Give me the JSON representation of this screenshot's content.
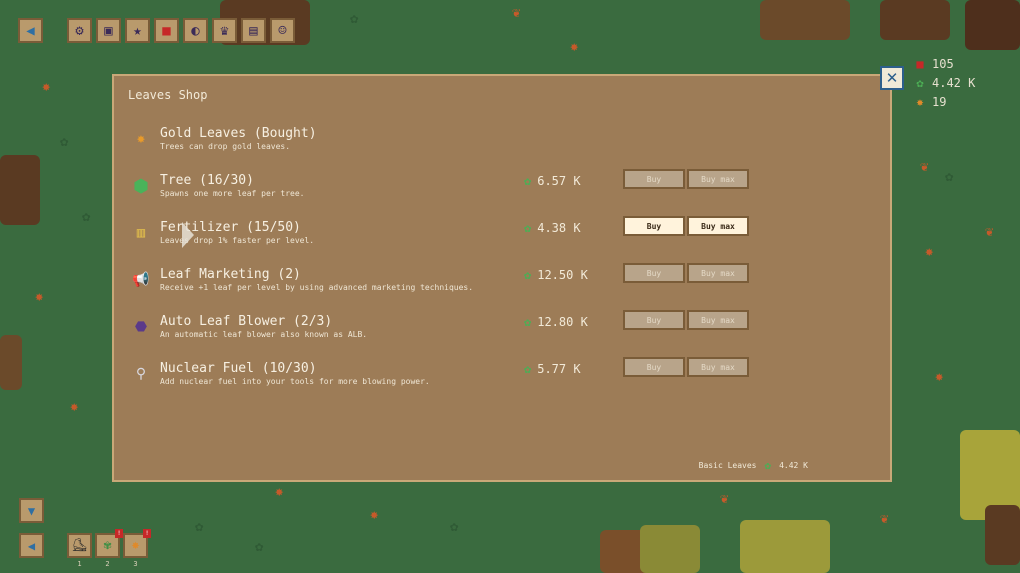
{
  "toolbar": {
    "icons": [
      "back-icon",
      "gear-icon",
      "briefcase-icon",
      "star-icon",
      "gem-icon",
      "moon-icon",
      "trophy-icon",
      "book-icon",
      "person-icon"
    ]
  },
  "stats": {
    "gems": "105",
    "leaves": "4.42 K",
    "gold_leaves": "19"
  },
  "shop": {
    "title": "Leaves Shop",
    "items": [
      {
        "name": "Gold Leaves (Bought)",
        "desc": "Trees can drop gold leaves.",
        "cost": "",
        "buy": "",
        "buy_max": "",
        "state": "bought",
        "icon": "maple-leaf-icon"
      },
      {
        "name": "Tree (16/30)",
        "desc": "Spawns one more leaf per tree.",
        "cost": "6.57 K",
        "buy": "Buy",
        "buy_max": "Buy max",
        "state": "disabled",
        "icon": "tree-icon"
      },
      {
        "name": "Fertilizer (15/50)",
        "desc": "Leaves drop 1% faster per level.",
        "cost": "4.38 K",
        "buy": "Buy",
        "buy_max": "Buy max",
        "state": "enabled",
        "icon": "fertilizer-bag-icon"
      },
      {
        "name": "Leaf Marketing (2)",
        "desc": "Receive +1 leaf per level by using advanced marketing techniques.",
        "cost": "12.50 K",
        "buy": "Buy",
        "buy_max": "Buy max",
        "state": "disabled",
        "icon": "megaphone-icon"
      },
      {
        "name": "Auto Leaf Blower (2/3)",
        "desc": "An automatic leaf blower also known as ALB.",
        "cost": "12.80 K",
        "buy": "Buy",
        "buy_max": "Buy max",
        "state": "disabled",
        "icon": "leaf-blower-icon"
      },
      {
        "name": "Nuclear Fuel (10/30)",
        "desc": "Add nuclear fuel into your tools for more blowing power.",
        "cost": "5.77 K",
        "buy": "Buy",
        "buy_max": "Buy max",
        "state": "disabled",
        "icon": "fuel-rod-icon"
      }
    ],
    "footer_label": "Basic Leaves",
    "footer_value": "4.42 K"
  },
  "close_label": "✕",
  "hotbar": {
    "slots": [
      {
        "num": "1",
        "icon": "boot-icon",
        "badge": ""
      },
      {
        "num": "2",
        "icon": "cannabis-leaf-icon",
        "badge": "!"
      },
      {
        "num": "3",
        "icon": "maple-leaf-icon",
        "badge": "!"
      }
    ]
  },
  "colors": {
    "grass": "#3a6b3f",
    "panel": "#9d7c57",
    "button_enabled": "#fff3dc",
    "button_disabled": "#b8a48a",
    "leaf_currency": "#4cae55"
  }
}
